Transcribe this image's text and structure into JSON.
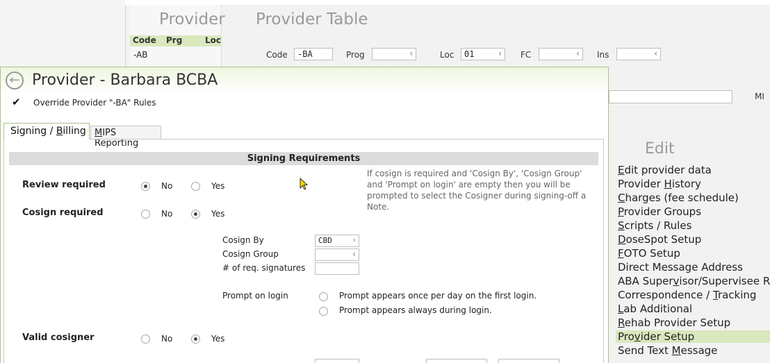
{
  "background": {
    "provider_panel": {
      "title": "Provider",
      "columns": [
        "Code",
        "Prg",
        "Loc"
      ],
      "rows": [
        "-AB"
      ]
    },
    "provider_table": {
      "title": "Provider Table",
      "filters": {
        "code_label": "Code",
        "code_value": "-BA",
        "prog_label": "Prog",
        "prog_value": "",
        "loc_label": "Loc",
        "loc_value": "01",
        "fc_label": "FC",
        "fc_value": "",
        "ins_label": "Ins",
        "ins_value": ""
      },
      "mi_label": "MI"
    },
    "edit_menu": {
      "title": "Edit",
      "items": [
        {
          "pre": "",
          "u": "E",
          "post": "dit provider data"
        },
        {
          "pre": "Provider ",
          "u": "H",
          "post": "istory"
        },
        {
          "pre": "",
          "u": "C",
          "post": "harges (fee schedule)"
        },
        {
          "pre": "",
          "u": "P",
          "post": "rovider Groups"
        },
        {
          "pre": "",
          "u": "S",
          "post": "cripts / Rules"
        },
        {
          "pre": "",
          "u": "D",
          "post": "oseSpot Setup"
        },
        {
          "pre": "",
          "u": "F",
          "post": "OTO Setup"
        },
        {
          "pre": "Direct Message Address",
          "u": "",
          "post": ""
        },
        {
          "pre": "ABA Super",
          "u": "v",
          "post": "isor/Supervisee Rec"
        },
        {
          "pre": "Correspondence / ",
          "u": "T",
          "post": "racking"
        },
        {
          "pre": "",
          "u": "L",
          "post": "ab Additional"
        },
        {
          "pre": "",
          "u": "R",
          "post": "ehab Provider Setup"
        },
        {
          "pre": "Pro",
          "u": "v",
          "post": "ider Setup"
        },
        {
          "pre": "Send Text ",
          "u": "M",
          "post": "essage"
        }
      ],
      "selected_index": 12
    }
  },
  "dialog": {
    "title": "Provider - Barbara BCBA",
    "override_checked": true,
    "override_label": "Override Provider \"-BA\" Rules",
    "tabs": {
      "active_pre": "Signing / ",
      "active_u": "B",
      "active_post": "illing",
      "inactive_pre": "",
      "inactive_u": "M",
      "inactive_post": "IPS Reporting"
    },
    "section_title": "Signing Requirements",
    "review": {
      "label": "Review required",
      "no": "No",
      "yes": "Yes",
      "value": "No"
    },
    "cosign": {
      "label": "Cosign required",
      "no": "No",
      "yes": "Yes",
      "value": "Yes"
    },
    "cosign_by_label": "Cosign By",
    "cosign_by_value": "CBD",
    "cosign_group_label": "Cosign Group",
    "cosign_group_value": "",
    "req_signatures_label": "# of req. signatures",
    "req_signatures_value": "",
    "help_text": "If cosign is required and 'Cosign By', 'Cosign Group' and 'Prompt on login' are empty then you will be prompted to select the Cosigner during signing-off a Note.",
    "prompt_label": "Prompt on login",
    "prompt_options": [
      "Prompt appears once per day on the first login.",
      "Prompt appears always during login."
    ],
    "valid_cosigner": {
      "label": "Valid cosigner",
      "no": "No",
      "yes": "Yes",
      "value": "Yes"
    }
  }
}
